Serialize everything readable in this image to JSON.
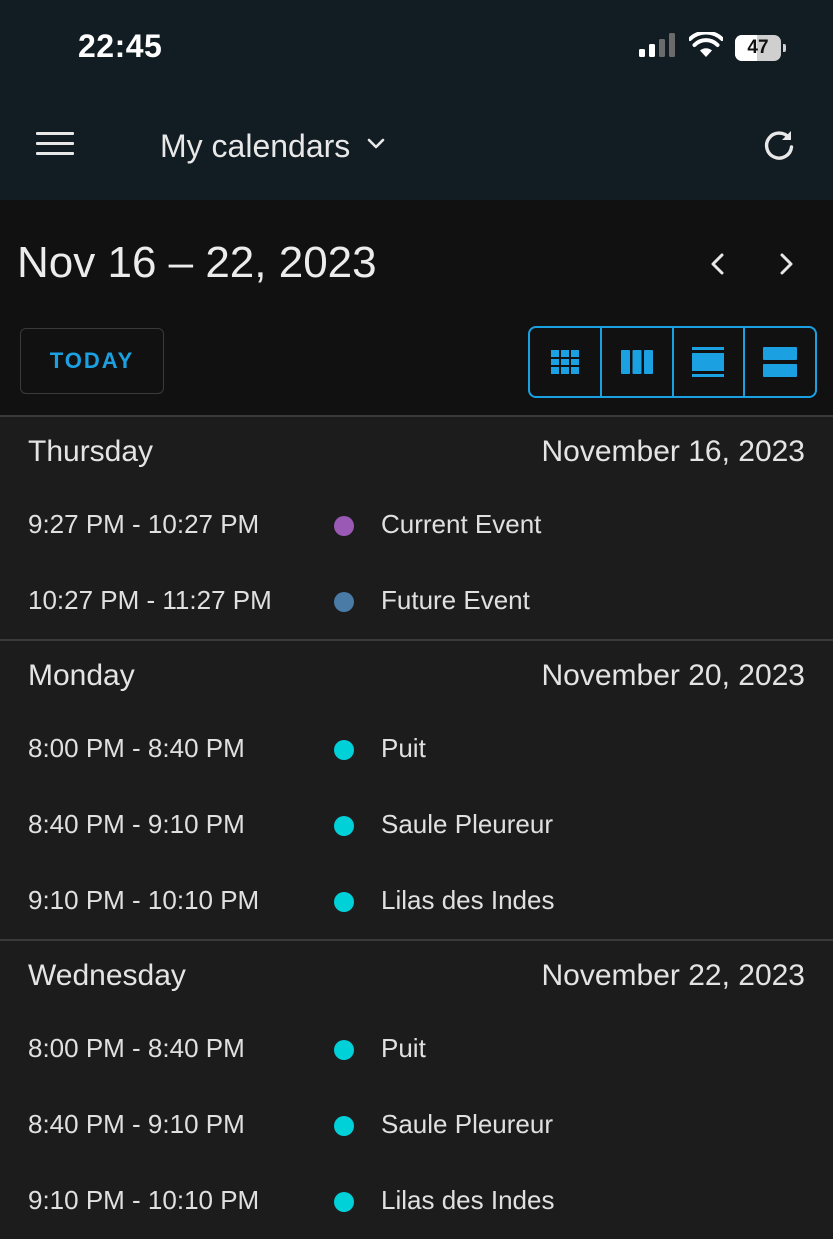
{
  "status_bar": {
    "time": "22:45",
    "battery": "47"
  },
  "header": {
    "title": "My calendars"
  },
  "toolbar": {
    "range": "Nov 16 – 22, 2023",
    "today_label": "TODAY"
  },
  "colors": {
    "accent": "#1ba1e2",
    "purple": "#9b59b6",
    "slate": "#4a7aa6",
    "teal": "#00d0d8"
  },
  "days": [
    {
      "name": "Thursday",
      "date": "November 16, 2023",
      "events": [
        {
          "time": "9:27 PM - 10:27 PM",
          "title": "Current Event",
          "color": "#9b59b6"
        },
        {
          "time": "10:27 PM - 11:27 PM",
          "title": "Future Event",
          "color": "#4a7aa6"
        }
      ]
    },
    {
      "name": "Monday",
      "date": "November 20, 2023",
      "events": [
        {
          "time": "8:00 PM - 8:40 PM",
          "title": "Puit",
          "color": "#00d0d8"
        },
        {
          "time": "8:40 PM - 9:10 PM",
          "title": "Saule Pleureur",
          "color": "#00d0d8"
        },
        {
          "time": "9:10 PM - 10:10 PM",
          "title": "Lilas des Indes",
          "color": "#00d0d8"
        }
      ]
    },
    {
      "name": "Wednesday",
      "date": "November 22, 2023",
      "events": [
        {
          "time": "8:00 PM - 8:40 PM",
          "title": "Puit",
          "color": "#00d0d8"
        },
        {
          "time": "8:40 PM - 9:10 PM",
          "title": "Saule Pleureur",
          "color": "#00d0d8"
        },
        {
          "time": "9:10 PM - 10:10 PM",
          "title": "Lilas des Indes",
          "color": "#00d0d8"
        }
      ]
    }
  ]
}
